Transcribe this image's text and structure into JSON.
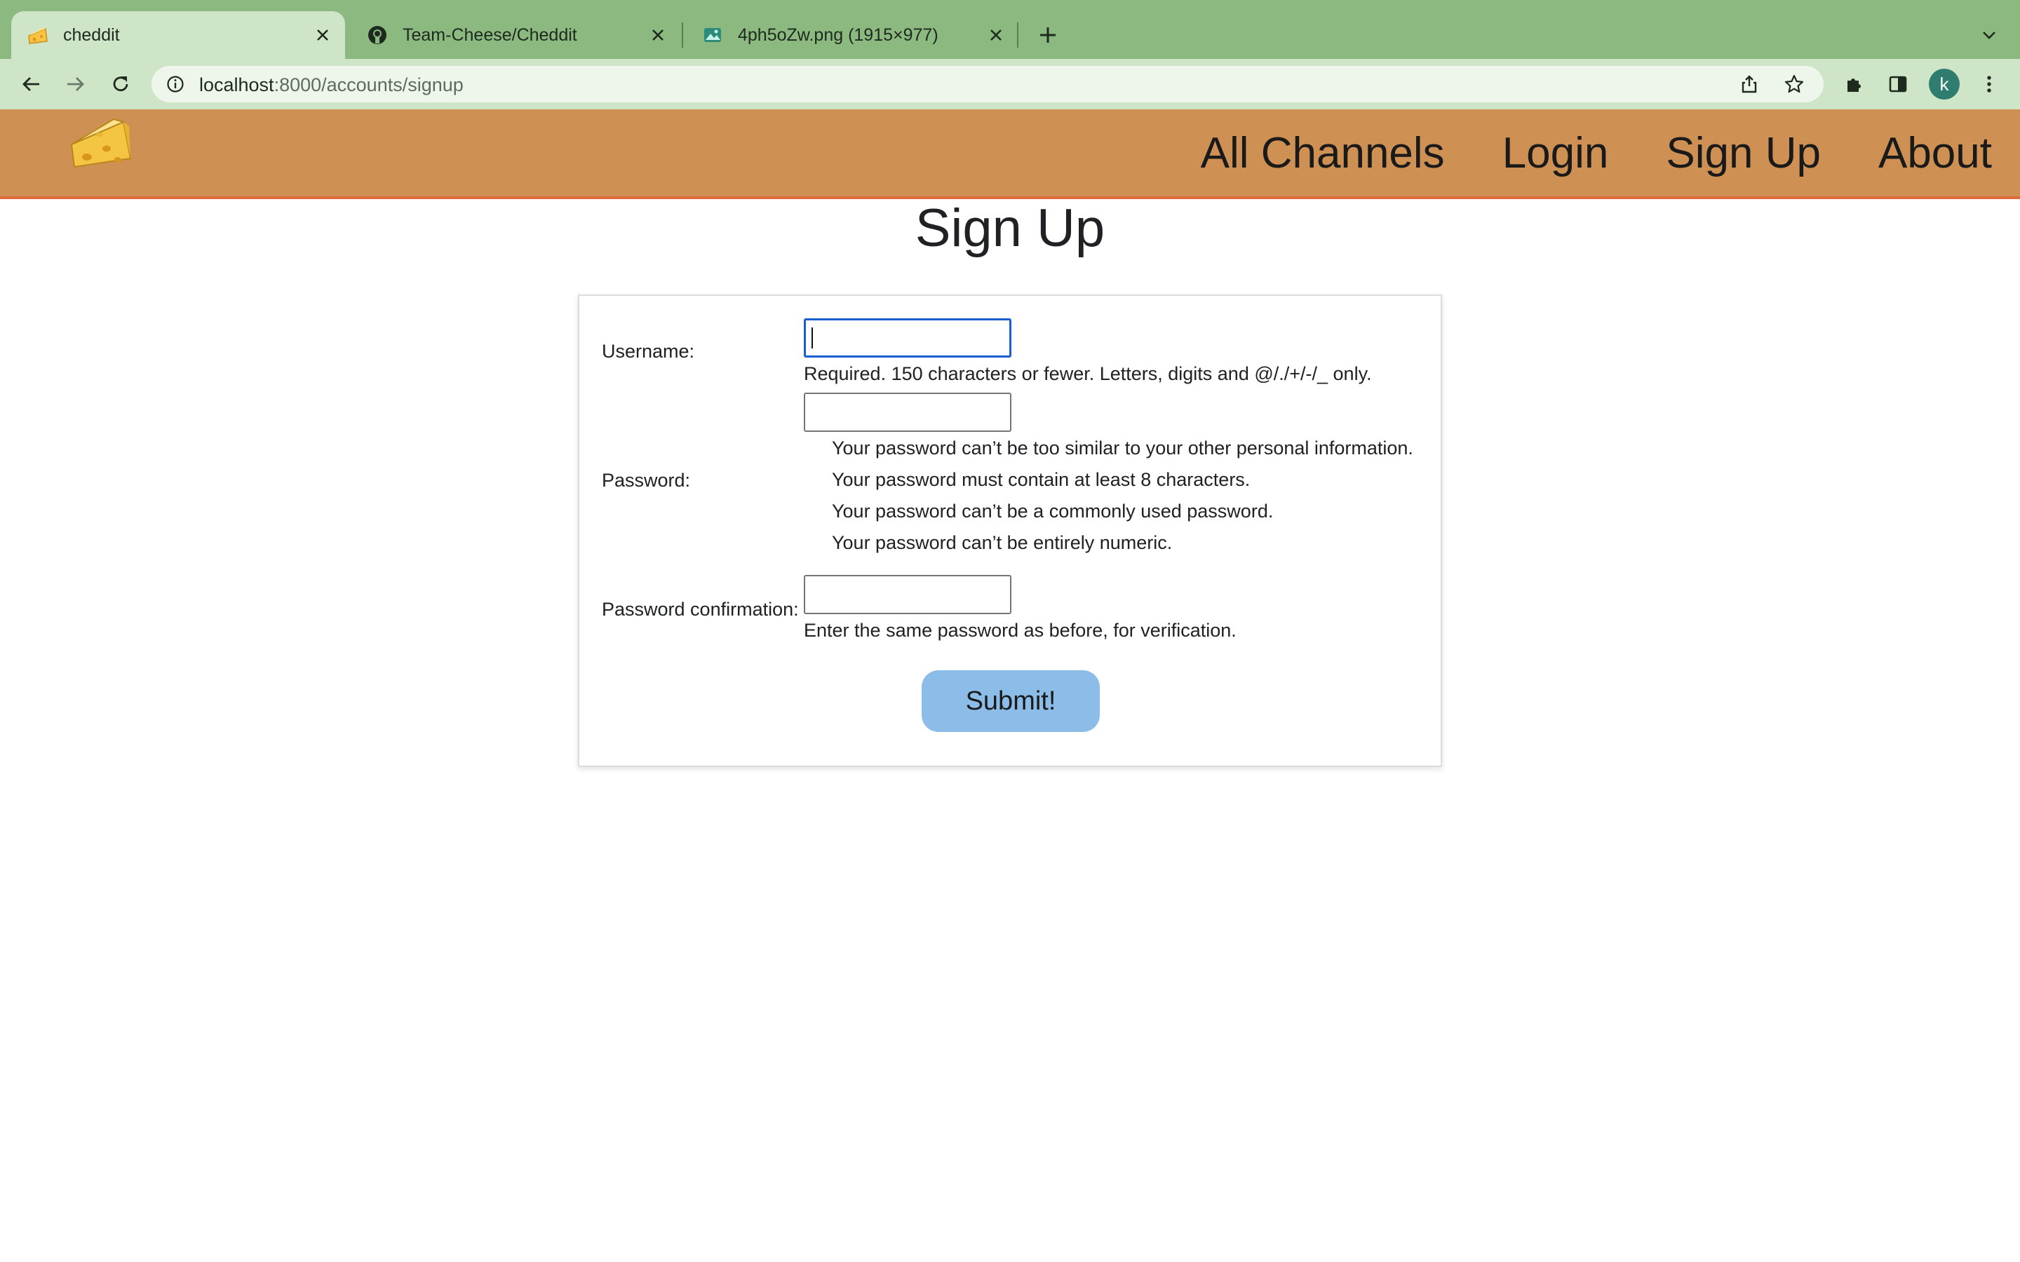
{
  "browser": {
    "tabs": [
      {
        "title": "cheddit",
        "icon": "cheese-favicon",
        "active": true
      },
      {
        "title": "Team-Cheese/Cheddit",
        "icon": "github-icon",
        "active": false
      },
      {
        "title": "4ph5oZw.png (1915×977)",
        "icon": "image-favicon",
        "active": false
      }
    ],
    "url": {
      "host": "localhost",
      "path": ":8000/accounts/signup"
    },
    "profile_initial": "k"
  },
  "site": {
    "logo": "cheese-logo",
    "nav": [
      "All Channels",
      "Login",
      "Sign Up",
      "About"
    ]
  },
  "page": {
    "title": "Sign Up",
    "form": {
      "username": {
        "label": "Username:",
        "value": "",
        "help": "Required. 150 characters or fewer. Letters, digits and @/./+/-/_ only."
      },
      "password": {
        "label": "Password:",
        "value": "",
        "rules": [
          "Your password can’t be too similar to your other personal information.",
          "Your password must contain at least 8 characters.",
          "Your password can’t be a commonly used password.",
          "Your password can’t be entirely numeric."
        ]
      },
      "password_confirmation": {
        "label": "Password confirmation:",
        "value": "",
        "help": "Enter the same password as before, for verification."
      },
      "submit_label": "Submit!"
    }
  },
  "colors": {
    "tabstrip": "#8bb980",
    "toolbar": "#cfe5c8",
    "site_nav": "#cf9053",
    "site_nav_border": "#e2693a",
    "submit_button": "#8cbde9",
    "focus_ring": "#1a5fd0"
  }
}
